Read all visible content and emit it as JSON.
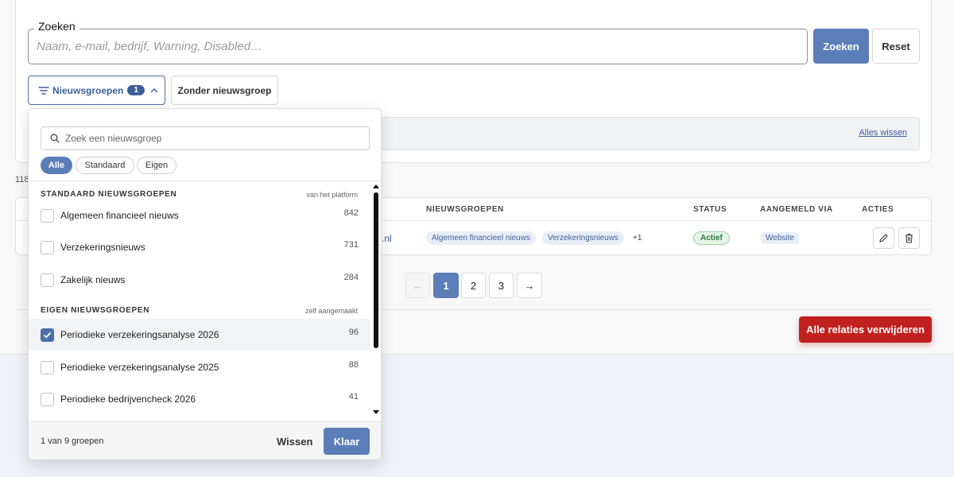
{
  "search": {
    "legend": "Zoeken",
    "placeholder": "Naam, e-mail, bedrijf, Warning, Disabled…",
    "submit_label": "Zoeken",
    "reset_label": "Reset"
  },
  "filters": {
    "newsgroups_label": "Nieuwsgroepen",
    "newsgroups_count": "1",
    "without_group_label": "Zonder nieuwsgroep",
    "clear_all_label": "Alles wissen"
  },
  "results_count_prefix": "118",
  "table": {
    "headers": {
      "newsgroups": "NIEUWSGROEPEN",
      "status": "STATUS",
      "via": "AANGEMELD VIA",
      "actions": "ACTIES"
    },
    "row": {
      "email_tail": ".nl",
      "tags": [
        "Algemeen financieel nieuws",
        "Verzekeringsnieuws"
      ],
      "more": "+1",
      "status": "Actief",
      "via": "Website"
    }
  },
  "pagination": {
    "prev": "←",
    "pages": [
      "1",
      "2",
      "3"
    ],
    "current": "1",
    "next": "→"
  },
  "delete_all_label": "Alle relaties verwijderen",
  "dropdown": {
    "search_placeholder": "Zoek een nieuwsgroep",
    "segments": [
      "Alle",
      "Standaard",
      "Eigen"
    ],
    "active_segment": "Alle",
    "standard_section": {
      "title": "STANDAARD NIEUWSGROEPEN",
      "note": "van het platform",
      "items": [
        {
          "label": "Algemeen financieel nieuws",
          "count": "842",
          "checked": false
        },
        {
          "label": "Verzekeringsnieuws",
          "count": "731",
          "checked": false
        },
        {
          "label": "Zakelijk nieuws",
          "count": "284",
          "checked": false
        }
      ]
    },
    "own_section": {
      "title": "EIGEN NIEUWSGROEPEN",
      "note": "zelf aangemaakt",
      "items": [
        {
          "label": "Periodieke verzekeringsanalyse 2026",
          "count": "96",
          "checked": true
        },
        {
          "label": "Periodieke verzekeringsanalyse 2025",
          "count": "88",
          "checked": false
        },
        {
          "label": "Periodieke bedrijvencheck 2026",
          "count": "41",
          "checked": false
        }
      ]
    },
    "footer": {
      "selection_text": "1 van 9 groepen",
      "clear_label": "Wissen",
      "done_label": "Klaar"
    }
  },
  "colors": {
    "primary": "#5b7db8",
    "danger": "#c0211f",
    "success": "#2c7a3f"
  }
}
